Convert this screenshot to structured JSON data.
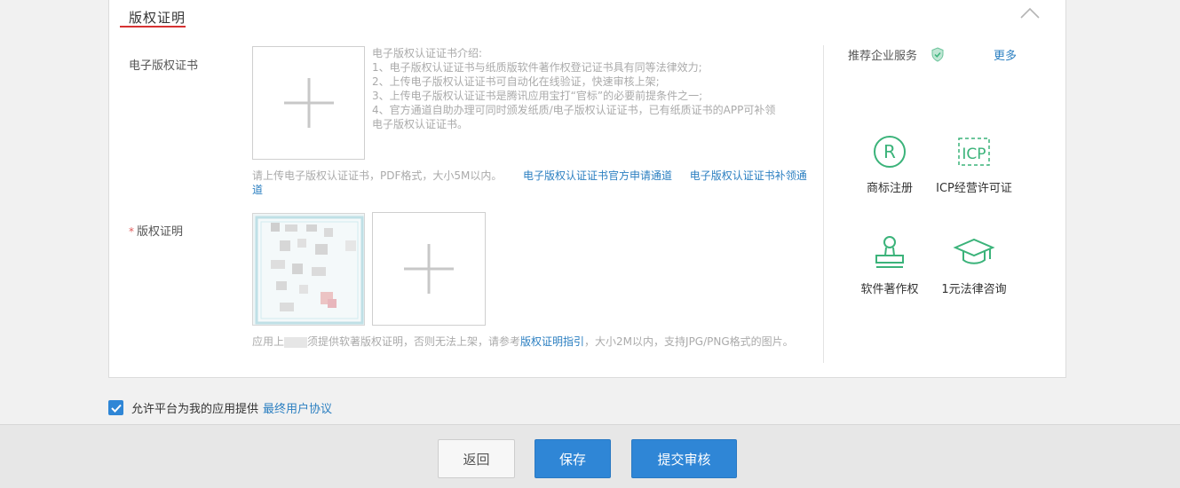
{
  "section": {
    "title": "版权证明"
  },
  "ecert": {
    "label": "电子版权证书",
    "intro": [
      "电子版权认证证书介绍:",
      "1、电子版权认证证书与纸质版软件著作权登记证书具有同等法律效力;",
      "2、上传电子版权认证证书可自动化在线验证，快速审核上架;",
      "3、上传电子版权认证证书是腾讯应用宝打“官标”的必要前提条件之一;",
      "4、官方通道自助办理可同时颁发纸质/电子版权认证证书，已有纸质证书的APP可补领",
      "电子版权认证证书。"
    ],
    "hint": "请上传电子版权认证证书，PDF格式，大小5M以内。",
    "link_apply": "电子版权认证证书官方申请通道",
    "link_reissue_1": "电子版权认证证书补领通",
    "link_reissue_2": "道"
  },
  "copyright": {
    "required_mark": "*",
    "label": "版权证明",
    "hint_prefix": "应用上",
    "hint_mid": "须提供软著版权证明，否则无法上架，请参考",
    "hint_link": "版权证明指引",
    "hint_suffix": "，大小2M以内，支持JPG/PNG格式的图片。"
  },
  "services": {
    "title": "推荐企业服务",
    "more": "更多",
    "items": [
      {
        "label": "商标注册",
        "icon": "registered-trademark-icon"
      },
      {
        "label": "ICP经营许可证",
        "icon": "icp-icon"
      },
      {
        "label": "软件著作权",
        "icon": "stamp-icon"
      },
      {
        "label": "1元法律咨询",
        "icon": "graduation-cap-icon"
      }
    ],
    "accent": "#3bb37a"
  },
  "agreement": {
    "text": "允许平台为我的应用提供",
    "link": "最终用户协议",
    "checked": true
  },
  "footer": {
    "back": "返回",
    "save": "保存",
    "submit": "提交审核"
  },
  "colors": {
    "primary": "#2f86d6",
    "link": "#2b7fc1",
    "required": "#e15b5b"
  }
}
